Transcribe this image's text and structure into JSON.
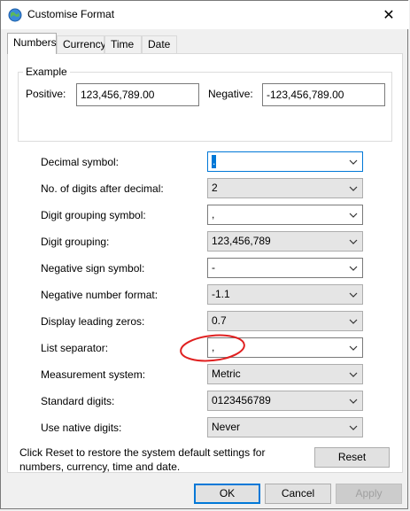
{
  "window": {
    "title": "Customise Format",
    "close_glyph": "✕"
  },
  "tabs": [
    {
      "label": "Numbers",
      "active": true
    },
    {
      "label": "Currency",
      "active": false
    },
    {
      "label": "Time",
      "active": false
    },
    {
      "label": "Date",
      "active": false
    }
  ],
  "example": {
    "legend": "Example",
    "positive_label": "Positive:",
    "positive_value": "123,456,789.00",
    "negative_label": "Negative:",
    "negative_value": "-123,456,789.00"
  },
  "settings": [
    {
      "label": "Decimal symbol:",
      "value": ".",
      "kind": "editable",
      "focused": true
    },
    {
      "label": "No. of digits after decimal:",
      "value": "2",
      "kind": "dropdown"
    },
    {
      "label": "Digit grouping symbol:",
      "value": ",",
      "kind": "editable"
    },
    {
      "label": "Digit grouping:",
      "value": "123,456,789",
      "kind": "dropdown"
    },
    {
      "label": "Negative sign symbol:",
      "value": "-",
      "kind": "editable"
    },
    {
      "label": "Negative number format:",
      "value": "-1.1",
      "kind": "dropdown"
    },
    {
      "label": "Display leading zeros:",
      "value": "0.7",
      "kind": "dropdown"
    },
    {
      "label": "List separator:",
      "value": ",",
      "kind": "editable"
    },
    {
      "label": "Measurement system:",
      "value": "Metric",
      "kind": "dropdown"
    },
    {
      "label": "Standard digits:",
      "value": "0123456789",
      "kind": "dropdown"
    },
    {
      "label": "Use native digits:",
      "value": "Never",
      "kind": "dropdown"
    }
  ],
  "footer": {
    "note": "Click Reset to restore the system default settings for numbers, currency, time and date.",
    "reset_label": "Reset",
    "ok_label": "OK",
    "cancel_label": "Cancel",
    "apply_label": "Apply"
  },
  "colors": {
    "accent": "#0078d7",
    "annotation": "#e02020"
  }
}
